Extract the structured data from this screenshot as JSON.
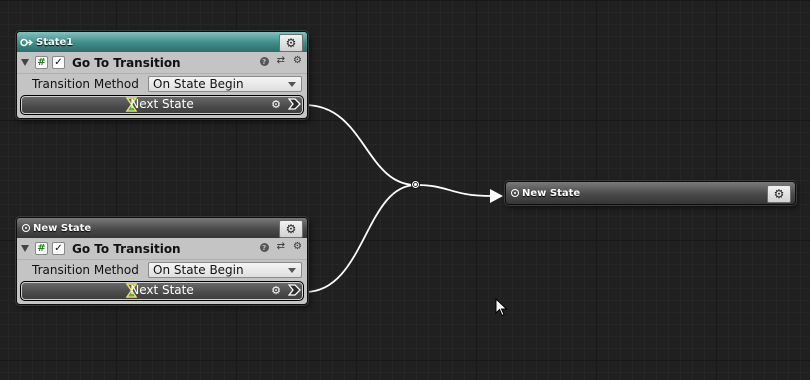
{
  "nodes": [
    {
      "title": "State1",
      "action": {
        "title": "Go To Transition",
        "field_label": "Transition Method",
        "field_value": "On State Begin",
        "output_label": "Next State"
      }
    },
    {
      "title": "New State",
      "action": {
        "title": "Go To Transition",
        "field_label": "Transition Method",
        "field_value": "On State Begin",
        "output_label": "Next State"
      }
    },
    {
      "title": "New State"
    }
  ],
  "colors": {
    "grid_background": "#202020",
    "node_body": "#c4c4c4",
    "header_accent": "#3f8c88",
    "header_default": "#4a4a4a",
    "wire": "#ffffff",
    "enabled_hash": "#1a8a1a"
  },
  "icons": {
    "gear": "gear-icon",
    "help": "help-icon",
    "presets": "preset-icon",
    "hourglass": "hourglass-icon"
  }
}
